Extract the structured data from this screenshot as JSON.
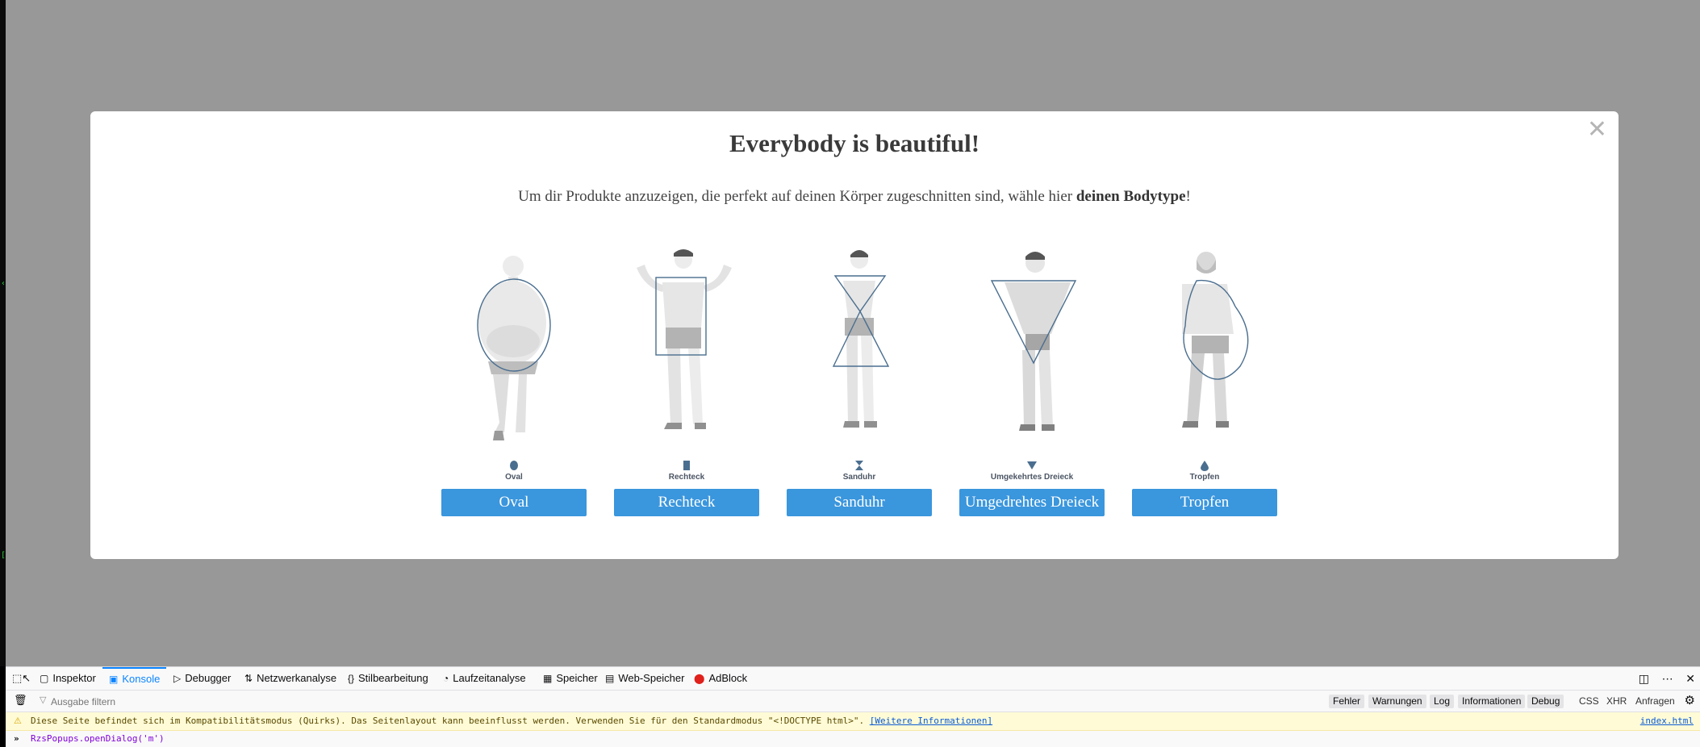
{
  "modal": {
    "title": "Everybody is beautiful!",
    "subtitle_pre": "Um dir Produkte anzuzeigen, die perfekt auf deinen Körper zugeschnitten sind, wähle hier ",
    "subtitle_bold": "deinen Bodytype",
    "subtitle_post": "!",
    "close_glyph": "✕",
    "body_types": [
      {
        "caption": "Oval",
        "button": "Oval",
        "icon": "oval-icon"
      },
      {
        "caption": "Rechteck",
        "button": "Rechteck",
        "icon": "rectangle-icon"
      },
      {
        "caption": "Sanduhr",
        "button": "Sanduhr",
        "icon": "hourglass-icon"
      },
      {
        "caption": "Umgekehrtes Dreieck",
        "button": "Umgedrehtes Dreieck",
        "icon": "inverted-triangle-icon"
      },
      {
        "caption": "Tropfen",
        "button": "Tropfen",
        "icon": "drop-icon"
      }
    ],
    "colors": {
      "button": "#3a96dd",
      "outline": "#4a6e8f",
      "overlay": "#989898"
    }
  },
  "devtools": {
    "tabs": [
      {
        "label": "Inspektor",
        "icon": "inspector-icon"
      },
      {
        "label": "Konsole",
        "icon": "console-icon",
        "active": true
      },
      {
        "label": "Debugger",
        "icon": "debugger-icon"
      },
      {
        "label": "Netzwerkanalyse",
        "icon": "network-icon"
      },
      {
        "label": "Stilbearbeitung",
        "icon": "style-editor-icon"
      },
      {
        "label": "Laufzeitanalyse",
        "icon": "performance-icon"
      },
      {
        "label": "Speicher",
        "icon": "memory-icon"
      },
      {
        "label": "Web-Speicher",
        "icon": "storage-icon"
      },
      {
        "label": "AdBlock",
        "icon": "adblock-icon"
      }
    ],
    "filter_placeholder": "Ausgabe filtern",
    "levels": [
      "Fehler",
      "Warnungen",
      "Log",
      "Informationen",
      "Debug"
    ],
    "extra_filters": [
      "CSS",
      "XHR",
      "Anfragen"
    ],
    "warning": {
      "text": "Diese Seite befindet sich im Kompatibilitätsmodus (Quirks). Das Seitenlayout kann beeinflusst werden. Verwenden Sie für den Standardmodus \"<!DOCTYPE html>\".",
      "link": "[Weitere Informationen]",
      "file": "index.html"
    },
    "command": "RzsPopups.openDialog('m')"
  }
}
